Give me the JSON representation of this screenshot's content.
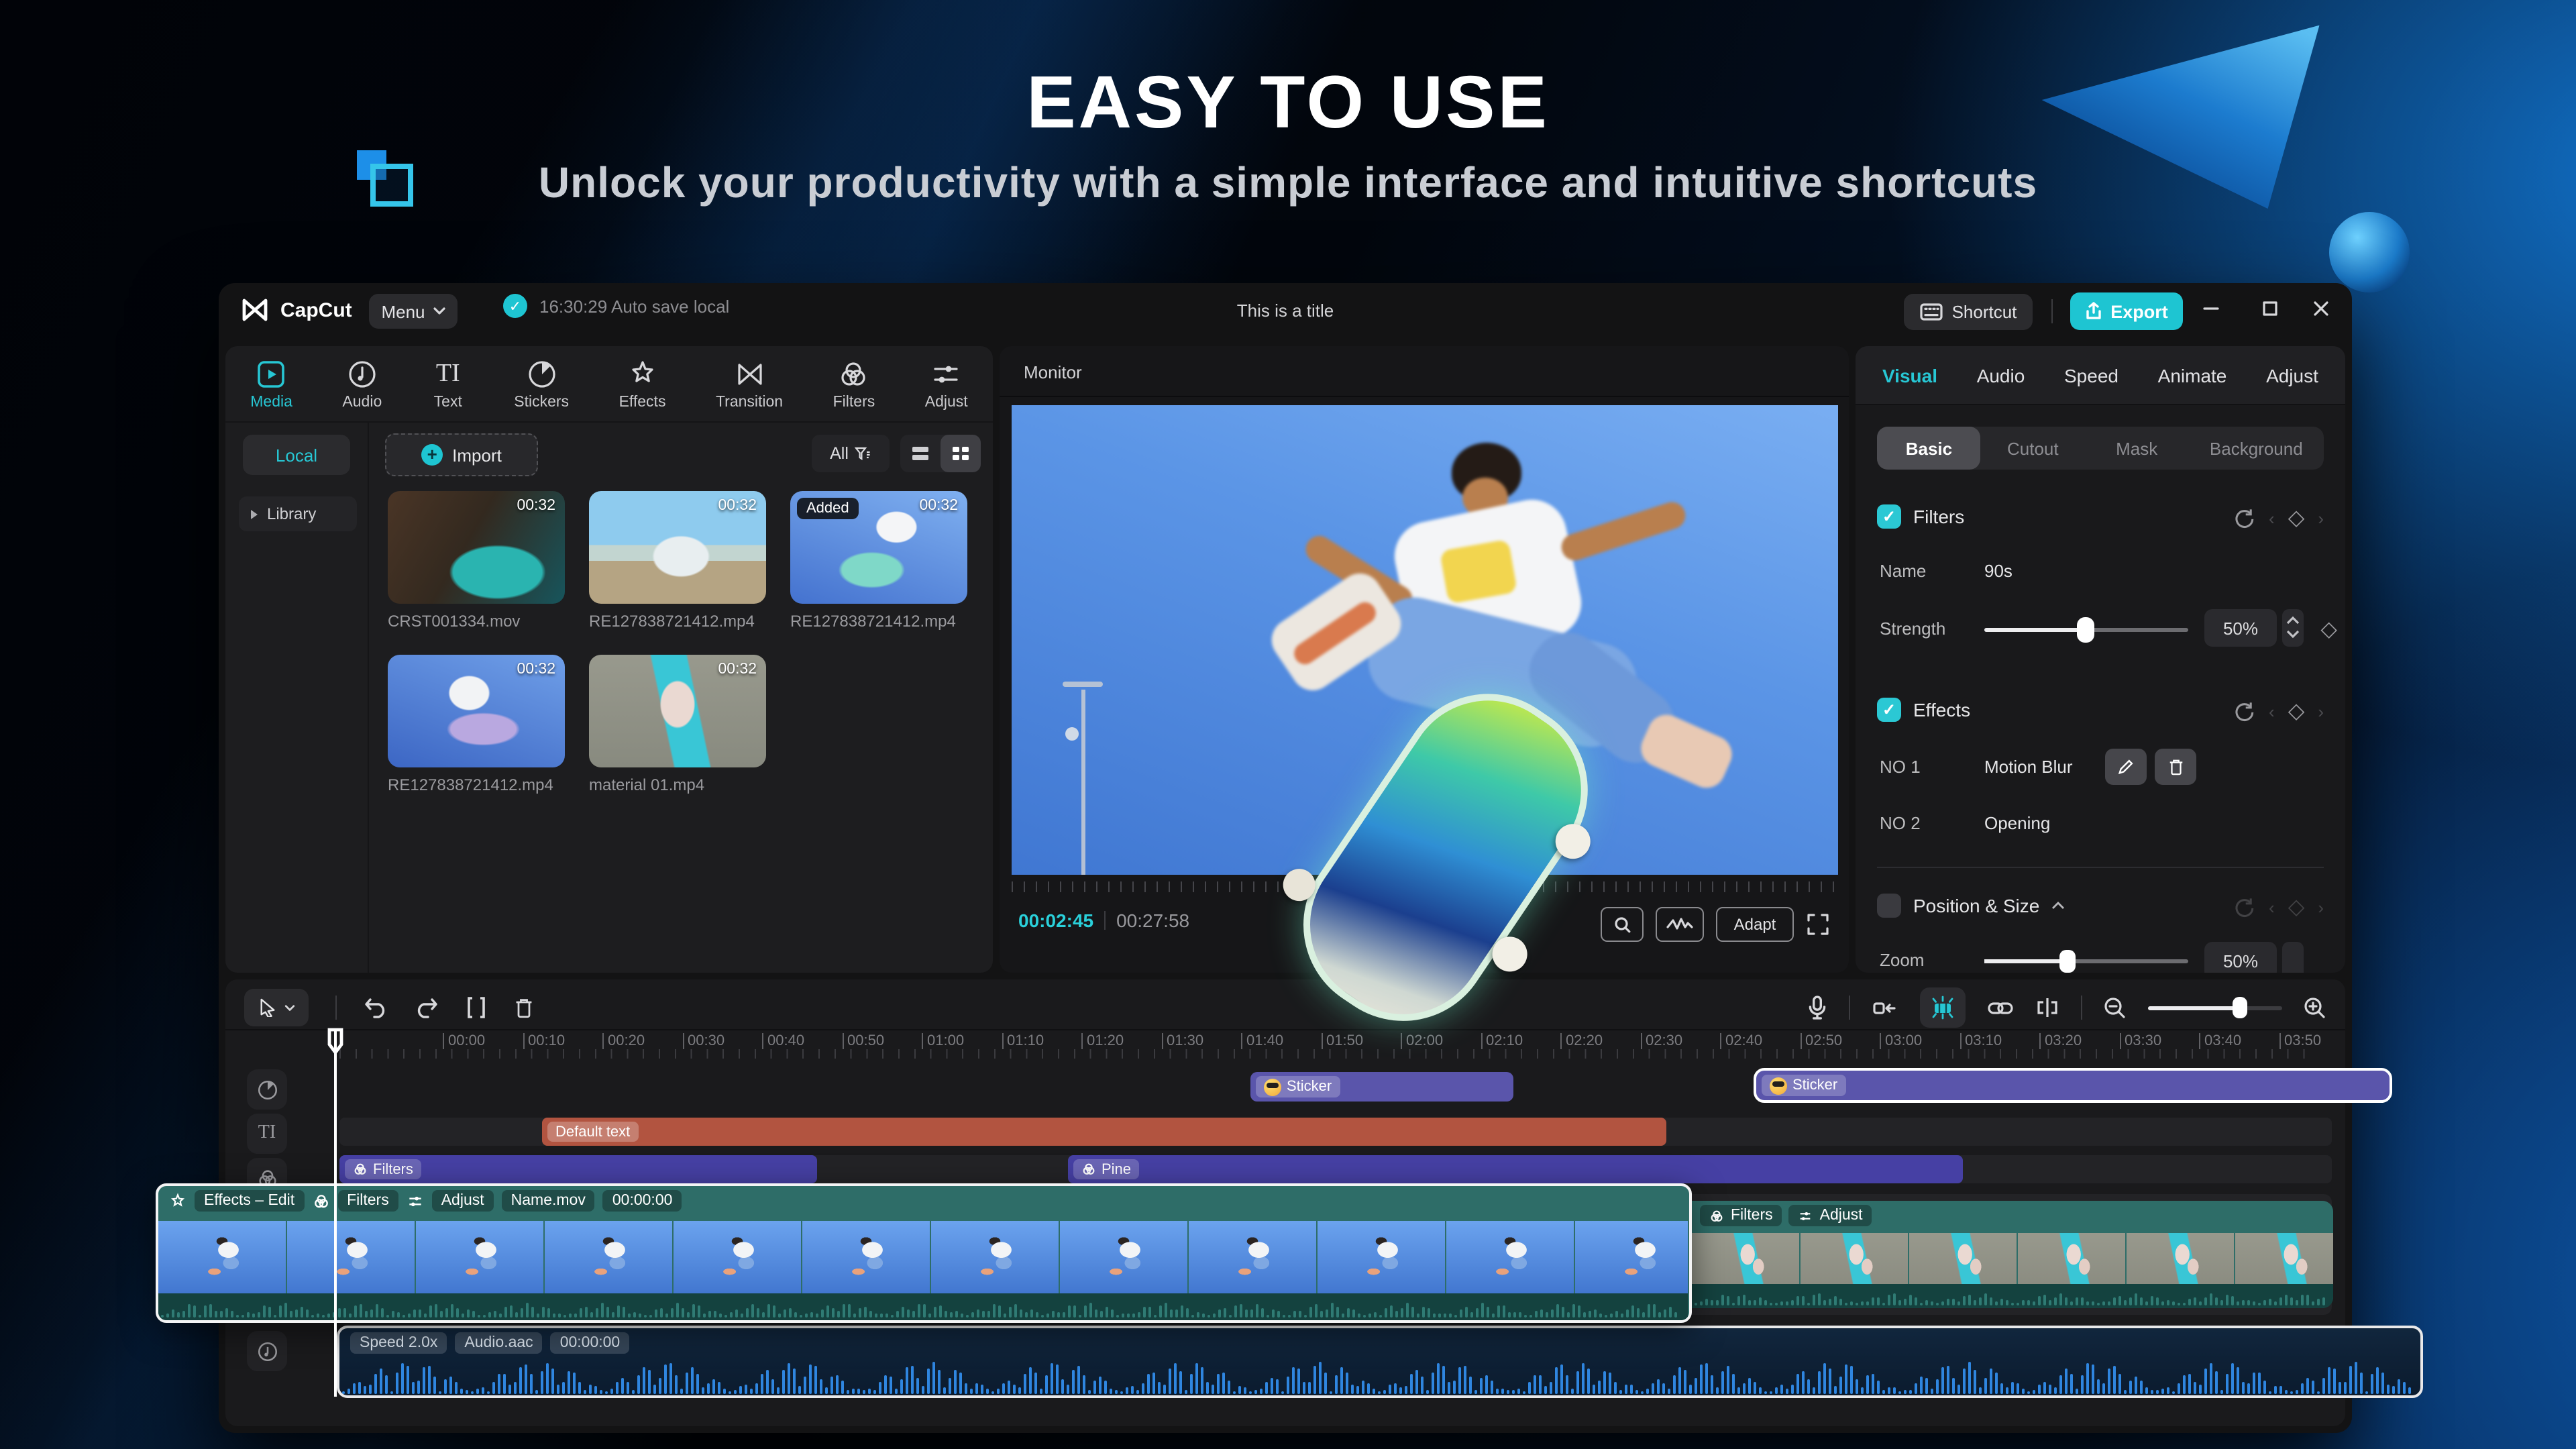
{
  "hero": {
    "title": "EASY TO USE",
    "subtitle": "Unlock your productivity with a simple interface and intuitive shortcuts"
  },
  "titlebar": {
    "app_name": "CapCut",
    "menu_label": "Menu",
    "autosave_text": "16:30:29 Auto save local",
    "doc_title": "This is a title",
    "shortcut_label": "Shortcut",
    "export_label": "Export"
  },
  "media_panel": {
    "tabs": [
      {
        "label": "Media"
      },
      {
        "label": "Audio"
      },
      {
        "label": "Text"
      },
      {
        "label": "Stickers"
      },
      {
        "label": "Effects"
      },
      {
        "label": "Transition"
      },
      {
        "label": "Filters"
      },
      {
        "label": "Adjust"
      }
    ],
    "active_tab": "Media",
    "local_label": "Local",
    "library_label": "Library",
    "import_label": "Import",
    "filter_all_label": "All",
    "items": [
      {
        "name": "CRST001334.mov",
        "duration": "00:32",
        "badge": ""
      },
      {
        "name": "RE127838721412.mp4",
        "duration": "00:32",
        "badge": ""
      },
      {
        "name": "RE127838721412.mp4",
        "duration": "00:32",
        "badge": "Added"
      },
      {
        "name": "RE127838721412.mp4",
        "duration": "00:32",
        "badge": ""
      },
      {
        "name": "material 01.mp4",
        "duration": "00:32",
        "badge": ""
      }
    ]
  },
  "monitor": {
    "title": "Monitor",
    "current_time": "00:02:45",
    "total_time": "00:27:58",
    "adapt_label": "Adapt"
  },
  "inspector": {
    "tabs": [
      {
        "label": "Visual"
      },
      {
        "label": "Audio"
      },
      {
        "label": "Speed"
      },
      {
        "label": "Animate"
      },
      {
        "label": "Adjust"
      }
    ],
    "active_tab": "Visual",
    "segments": [
      {
        "label": "Basic"
      },
      {
        "label": "Cutout"
      },
      {
        "label": "Mask"
      },
      {
        "label": "Background"
      }
    ],
    "active_segment": "Basic",
    "filters": {
      "label": "Filters",
      "name_label": "Name",
      "name_value": "90s",
      "strength_label": "Strength",
      "strength_value": "50%",
      "strength_pct": 50
    },
    "effects": {
      "label": "Effects",
      "rows": [
        {
          "no": "NO 1",
          "name": "Motion Blur"
        },
        {
          "no": "NO 2",
          "name": "Opening"
        }
      ]
    },
    "position_size": {
      "label": "Position & Size"
    },
    "zoom_row": {
      "label": "Zoom",
      "value": "50%"
    }
  },
  "timeline": {
    "ruler": [
      "00:00",
      "00:10",
      "00:20",
      "00:30",
      "00:40",
      "00:50",
      "01:00",
      "01:10",
      "01:20",
      "01:30",
      "01:40",
      "01:50",
      "02:00",
      "02:10",
      "02:20",
      "02:30",
      "02:40",
      "02:50",
      "03:00",
      "03:10",
      "03:20",
      "03:30",
      "03:40",
      "03:50"
    ],
    "sticker_clip_1": "Sticker",
    "sticker_clip_2": "Sticker",
    "text_clip": "Default text",
    "filters_clip": "Filters",
    "pine_clip": "Pine",
    "overlay_clip": {
      "badge_effects": "Effects – Edit",
      "badge_filters": "Filters",
      "badge_adjust": "Adjust",
      "badge_name": "Name.mov",
      "badge_time": "00:00:00"
    },
    "second_clip": {
      "badge_filters": "Filters",
      "badge_adjust": "Adjust"
    },
    "audio_clip": {
      "badge_speed": "Speed 2.0x",
      "badge_name": "Audio.aac",
      "badge_time": "00:00:00"
    }
  },
  "colors": {
    "accent_teal": "#27c7d4",
    "export_button": "#1ec5d2",
    "sticker_clip": "#5a55ab",
    "text_clip": "#b25440",
    "filter_clip": "#4640a4",
    "overlay_clip": "#2e6d68",
    "audio_clip": "#0d2034",
    "audio_wave": "#2f86e0"
  }
}
